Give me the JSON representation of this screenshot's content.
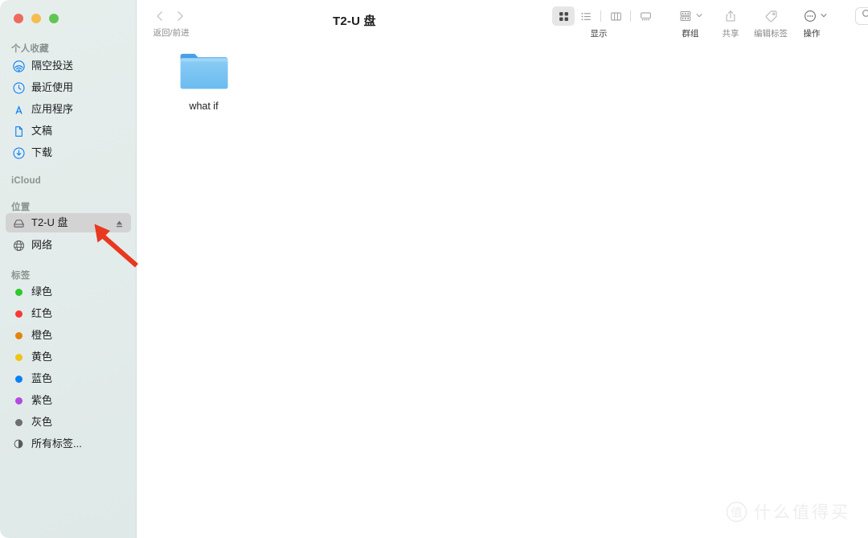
{
  "window": {
    "title": "T2-U 盘",
    "traffic_lights": [
      {
        "name": "close",
        "color": "#ed6a5e"
      },
      {
        "name": "minimize",
        "color": "#f5bd4f"
      },
      {
        "name": "maximize",
        "color": "#61c554"
      }
    ]
  },
  "toolbar": {
    "nav_label": "返回/前进",
    "view_label": "显示",
    "group_label": "群组",
    "share_label": "共享",
    "tags_label": "编辑标签",
    "action_label": "操作",
    "search_label": "搜索",
    "view_modes": [
      {
        "name": "icon-view",
        "icon": "grid-icon",
        "active": true
      },
      {
        "name": "list-view",
        "icon": "list-icon",
        "active": false
      },
      {
        "name": "column-view",
        "icon": "columns-icon",
        "active": false
      },
      {
        "name": "gallery-view",
        "icon": "gallery-icon",
        "active": false
      }
    ]
  },
  "search": {
    "value": "",
    "placeholder": "搜索"
  },
  "sidebar": {
    "sections": [
      {
        "title": "个人收藏",
        "items": [
          {
            "label": "隔空投送",
            "icon": "airdrop-icon"
          },
          {
            "label": "最近使用",
            "icon": "clock-icon"
          },
          {
            "label": "应用程序",
            "icon": "applications-icon"
          },
          {
            "label": "文稿",
            "icon": "document-icon"
          },
          {
            "label": "下载",
            "icon": "download-icon"
          }
        ]
      },
      {
        "title": "iCloud",
        "items": []
      },
      {
        "title": "位置",
        "items": [
          {
            "label": "T2-U 盘",
            "icon": "drive-icon",
            "selected": true,
            "eject": true
          },
          {
            "label": "网络",
            "icon": "network-icon",
            "selected": false,
            "eject": false
          }
        ]
      },
      {
        "title": "标签",
        "items": [
          {
            "label": "绿色",
            "icon": "tag-dot-icon",
            "color": "#2dc92d"
          },
          {
            "label": "红色",
            "icon": "tag-dot-icon",
            "color": "#f73a32"
          },
          {
            "label": "橙色",
            "icon": "tag-dot-icon",
            "color": "#e5820e"
          },
          {
            "label": "黄色",
            "icon": "tag-dot-icon",
            "color": "#f0c415"
          },
          {
            "label": "蓝色",
            "icon": "tag-dot-icon",
            "color": "#0a81f3"
          },
          {
            "label": "紫色",
            "icon": "tag-dot-icon",
            "color": "#b44ae0"
          },
          {
            "label": "灰色",
            "icon": "tag-dot-icon",
            "color": "#6e6e73"
          },
          {
            "label": "所有标签...",
            "icon": "all-tags-icon",
            "color": ""
          }
        ]
      }
    ]
  },
  "files": [
    {
      "name": "what if",
      "type": "folder"
    }
  ],
  "annotation": {
    "type": "arrow",
    "color": "#e8381f",
    "points_to": "eject-button"
  },
  "watermark": {
    "logo": "值",
    "text": "什么值得买"
  },
  "colors": {
    "accent_blue": "#0a7cf4",
    "sidebar_bg": "#e3ecea",
    "selection": "#d3d3d3"
  }
}
